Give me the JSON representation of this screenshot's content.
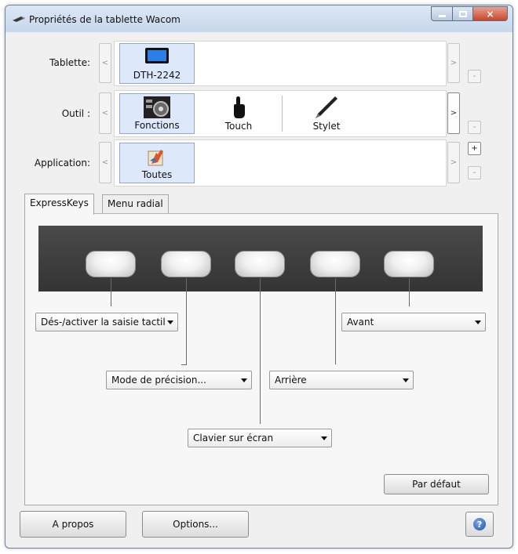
{
  "window": {
    "title": "Propriétés de la tablette Wacom",
    "controls": {
      "minimize": "minimize",
      "maximize": "maximize",
      "close": "×"
    }
  },
  "rows": {
    "tablet": {
      "label": "Tablette:",
      "items": [
        {
          "label": "DTH-2242",
          "icon": "tablet-display-icon",
          "selected": true
        }
      ]
    },
    "tool": {
      "label": "Outil :",
      "items": [
        {
          "label": "Fonctions",
          "icon": "functions-icon",
          "selected": true
        },
        {
          "label": "Touch",
          "icon": "touch-hand-icon",
          "selected": false
        },
        {
          "label": "Stylet",
          "icon": "stylus-pen-icon",
          "selected": false
        }
      ]
    },
    "application": {
      "label": "Application:",
      "items": [
        {
          "label": "Toutes",
          "icon": "all-applications-icon",
          "selected": true
        }
      ]
    },
    "nav": {
      "prev": "<",
      "next": ">",
      "add": "+",
      "remove": "-"
    }
  },
  "tabs": [
    {
      "label": "ExpressKeys",
      "active": true
    },
    {
      "label": "Menu radial",
      "active": false
    }
  ],
  "express_keys": {
    "key_count": 5,
    "dropdowns": [
      {
        "value": "Dés-/activer la saisie tactil"
      },
      {
        "value": "Mode de précision..."
      },
      {
        "value": "Clavier sur écran"
      },
      {
        "value": "Arrière"
      },
      {
        "value": "Avant"
      }
    ],
    "default_button": "Par défaut"
  },
  "footer": {
    "about_button": "A propos",
    "options_button": "Options...",
    "help_glyph": "?"
  },
  "colors": {
    "selected_tile": "#dde9fb",
    "device_panel": "#3c3c3c",
    "close_button": "#c7452b"
  }
}
